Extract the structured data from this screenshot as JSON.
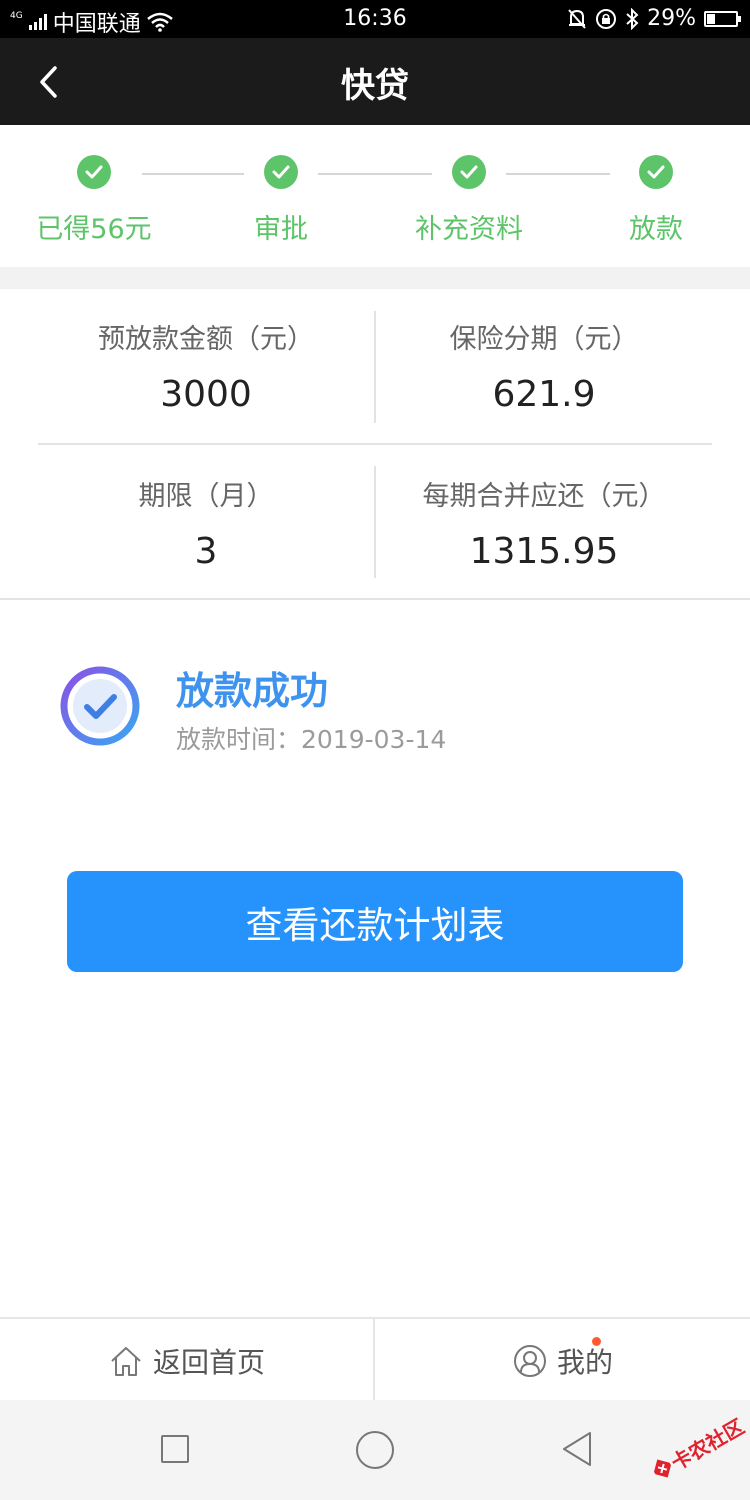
{
  "status_bar": {
    "network_type": "4G",
    "carrier": "中国联通",
    "time": "16:36",
    "battery_percent": "29%",
    "battery_level": 0.29
  },
  "navbar": {
    "title": "快贷"
  },
  "steps": [
    {
      "label": "已得56元",
      "done": true
    },
    {
      "label": "审批",
      "done": true
    },
    {
      "label": "补充资料",
      "done": true
    },
    {
      "label": "放款",
      "done": true
    }
  ],
  "step_color": "#5ec46a",
  "info": {
    "pre_loan_amount": {
      "title": "预放款金额（元）",
      "value": "3000"
    },
    "insurance_installment": {
      "title": "保险分期（元）",
      "value": "621.9"
    },
    "term": {
      "title": "期限（月）",
      "value": "3"
    },
    "per_period_payment": {
      "title": "每期合并应还（元）",
      "value": "1315.95"
    }
  },
  "result": {
    "title": "放款成功",
    "time_text": "放款时间：2019-03-14",
    "title_color": "#3d93ee"
  },
  "primary_button": {
    "label": "查看还款计划表",
    "color": "#2593fb"
  },
  "bottom_tabs": [
    {
      "label": "返回首页",
      "icon": "home-icon"
    },
    {
      "label": "我的",
      "icon": "user-icon",
      "has_badge": true
    }
  ],
  "watermark": {
    "text": "卡农社区"
  }
}
